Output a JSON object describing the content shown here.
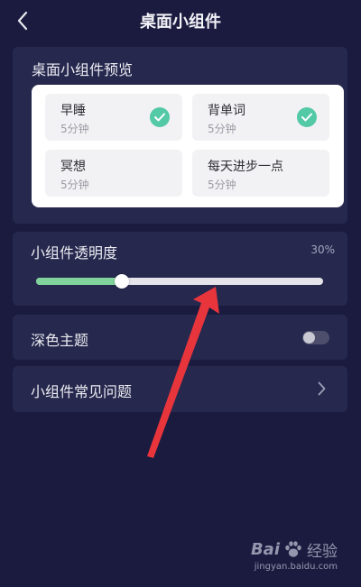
{
  "header": {
    "title": "桌面小组件"
  },
  "preview": {
    "title": "桌面小组件预览",
    "items": [
      {
        "name": "早睡",
        "duration": "5分钟",
        "checked": true
      },
      {
        "name": "背单词",
        "duration": "5分钟",
        "checked": true
      },
      {
        "name": "冥想",
        "duration": "5分钟",
        "checked": false
      },
      {
        "name": "每天进步一点",
        "duration": "5分钟",
        "checked": false
      }
    ]
  },
  "opacity": {
    "label": "小组件透明度",
    "value_text": "30%",
    "value": 0.3
  },
  "dark_theme": {
    "label": "深色主题",
    "enabled": false
  },
  "faq": {
    "label": "小组件常见问题"
  },
  "watermark": {
    "brand_left": "Bai",
    "brand_right": "经验",
    "url": "jingyan.baidu.com"
  },
  "icons": {
    "back": "chevron-left-icon",
    "check": "check-circle-icon",
    "chevron": "chevron-right-icon",
    "paw": "paw-icon"
  },
  "colors": {
    "background": "#1a1b3f",
    "card": "#26284e",
    "accent_green": "#54c9a6",
    "slider_fill": "#7fd39b",
    "annotation_arrow": "#e8353c"
  }
}
